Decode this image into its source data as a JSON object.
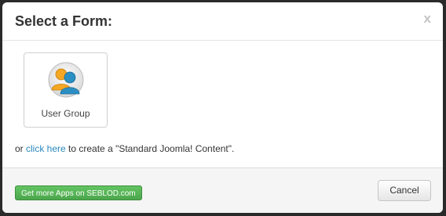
{
  "header": {
    "title": "Select a Form:",
    "close_label": "x"
  },
  "body": {
    "forms": [
      {
        "label": "User Group",
        "icon": "user-group-icon"
      }
    ],
    "standard_prefix": "or ",
    "standard_link": "click here",
    "standard_suffix": " to create a \"Standard Joomla! Content\"."
  },
  "footer": {
    "apps_button_label": "Get more Apps on SEBLOD.com",
    "cancel_label": "Cancel"
  },
  "colors": {
    "link": "#2a88bd",
    "apps_button": "#5bb75b",
    "icon_orange": "#f5a623",
    "icon_blue": "#2b8fc4"
  }
}
